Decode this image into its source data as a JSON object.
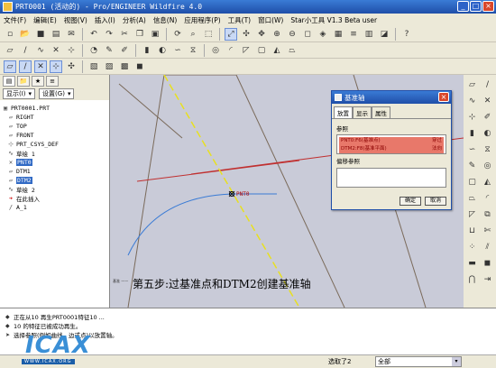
{
  "window": {
    "title": "PRT0001 (活动的) - Pro/ENGINEER Wildfire 4.0",
    "buttons": [
      "_",
      "□",
      "×"
    ]
  },
  "menu": [
    "文件(F)",
    "编辑(E)",
    "视图(V)",
    "插入(I)",
    "分析(A)",
    "信息(N)",
    "应用程序(P)",
    "工具(T)",
    "窗口(W)",
    "Star小工具 V1.3 Beta  user"
  ],
  "toolbar_icons": {
    "row1": [
      "new-icon",
      "open-icon",
      "save-icon",
      "print-icon",
      "email-icon",
      "undo-icon",
      "redo-icon",
      "cut-icon",
      "copy-icon",
      "paste-icon",
      "regenerate-icon",
      "find-icon",
      "select-icon",
      "repaint-icon",
      "spin-center-icon",
      "orient-icon",
      "zoom-in-icon",
      "zoom-out-icon",
      "refit-icon",
      "reorient-icon",
      "saved-views-icon",
      "layers-icon",
      "view-manager-icon",
      "display-style-icon",
      "help-icon"
    ],
    "row2": [
      "datum-plane-icon",
      "datum-axis-icon",
      "datum-curve-icon",
      "datum-point-icon",
      "csys-icon",
      "analysis-icon",
      "annotation-icon",
      "sketch-icon",
      "extrude-icon",
      "revolve-icon",
      "sweep-icon",
      "blend-icon",
      "hole-icon",
      "round-icon",
      "chamfer-icon",
      "shell-icon",
      "rib-icon",
      "draft-icon"
    ],
    "row3": [
      "datum-plane-display-icon",
      "axis-display-icon",
      "point-display-icon",
      "csys-display-icon",
      "spin-center-display-icon",
      "wireframe-icon",
      "hidden-line-icon",
      "no-hidden-icon",
      "shading-icon"
    ]
  },
  "left_panel": {
    "dropdowns": {
      "show": "显示(I)",
      "settings": "设置(G)"
    },
    "tree": [
      {
        "label": "PRT0001.PRT",
        "icon": "part-icon",
        "level": 0,
        "selected": false
      },
      {
        "label": "RIGHT",
        "icon": "plane-icon",
        "level": 1,
        "selected": false
      },
      {
        "label": "TOP",
        "icon": "plane-icon",
        "level": 1,
        "selected": false
      },
      {
        "label": "FRONT",
        "icon": "plane-icon",
        "level": 1,
        "selected": false
      },
      {
        "label": "PRT_CSYS_DEF",
        "icon": "csys-icon",
        "level": 1,
        "selected": false
      },
      {
        "label": "草绘 1",
        "icon": "sketch-icon",
        "level": 1,
        "selected": false
      },
      {
        "label": "PNT0",
        "icon": "point-icon",
        "level": 1,
        "selected": true
      },
      {
        "label": "DTM1",
        "icon": "plane-icon",
        "level": 1,
        "selected": false
      },
      {
        "label": "DTM2",
        "icon": "plane-icon",
        "level": 1,
        "selected": true
      },
      {
        "label": "草绘 2",
        "icon": "sketch-icon",
        "level": 1,
        "selected": false
      },
      {
        "label": "在此插入",
        "icon": "insert-arrow-icon",
        "level": 1,
        "selected": false
      },
      {
        "label": "A_1",
        "icon": "axis-icon",
        "level": 1,
        "selected": false
      }
    ]
  },
  "graphics": {
    "point_label": "PNT0",
    "caption": "第五步:过基准点和DTM2创建基准轴",
    "csys_label": "基准 ——"
  },
  "dialog": {
    "title": "基准轴",
    "tabs": [
      "放置",
      "显示",
      "属性"
    ],
    "references_label": "参照",
    "references": [
      {
        "name": "PNT0:F6(基准点)",
        "type": "穿过"
      },
      {
        "name": "DTM2:F8(基准平面)",
        "type": "法向"
      }
    ],
    "offset_label": "偏移参照",
    "ok": "确定",
    "cancel": "取消"
  },
  "messages": [
    "正在从10 再生PRT0001特征10 ...",
    "10 的特征已被成功再生。",
    "选择参照(例如曲线、边或点)以放置轴。"
  ],
  "status": {
    "selected": "选取了2",
    "filter": "全部"
  },
  "watermark": {
    "text": "ICAX",
    "url": "WWW.ICAX.ORG"
  },
  "colors": {
    "title_bar": "#1f4ea8",
    "selection": "#316ac5",
    "reference_highlight": "#e8786a",
    "graphics_bg": "#c9cbd8"
  }
}
